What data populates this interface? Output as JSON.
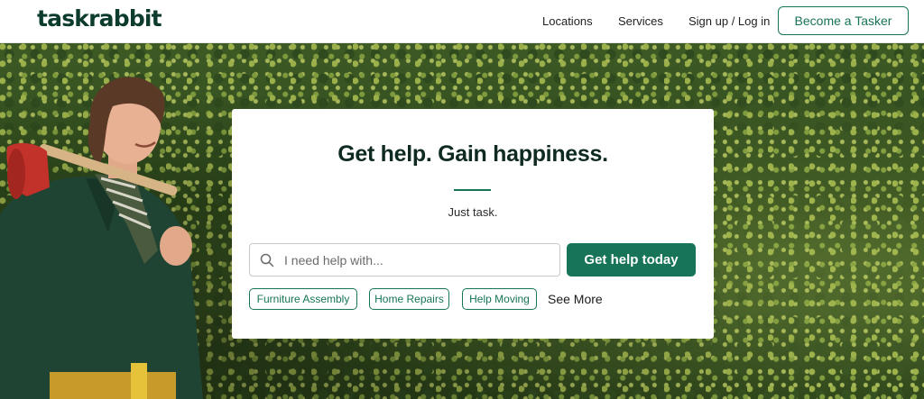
{
  "header": {
    "logo": "taskrabbit",
    "nav": {
      "locations": "Locations",
      "services": "Services",
      "signup": "Sign up / Log in"
    },
    "become_tasker": "Become a Tasker"
  },
  "hero": {
    "headline": "Get help. Gain happiness.",
    "tagline": "Just task.",
    "search": {
      "placeholder": "I need help with...",
      "icon": "search-icon"
    },
    "cta": "Get help today",
    "chips": [
      "Furniture Assembly",
      "Home Repairs",
      "Help Moving"
    ],
    "see_more": "See More"
  },
  "colors": {
    "brand_green": "#177458",
    "logo_green": "#0d3c2e",
    "headline": "#0e2a22"
  }
}
